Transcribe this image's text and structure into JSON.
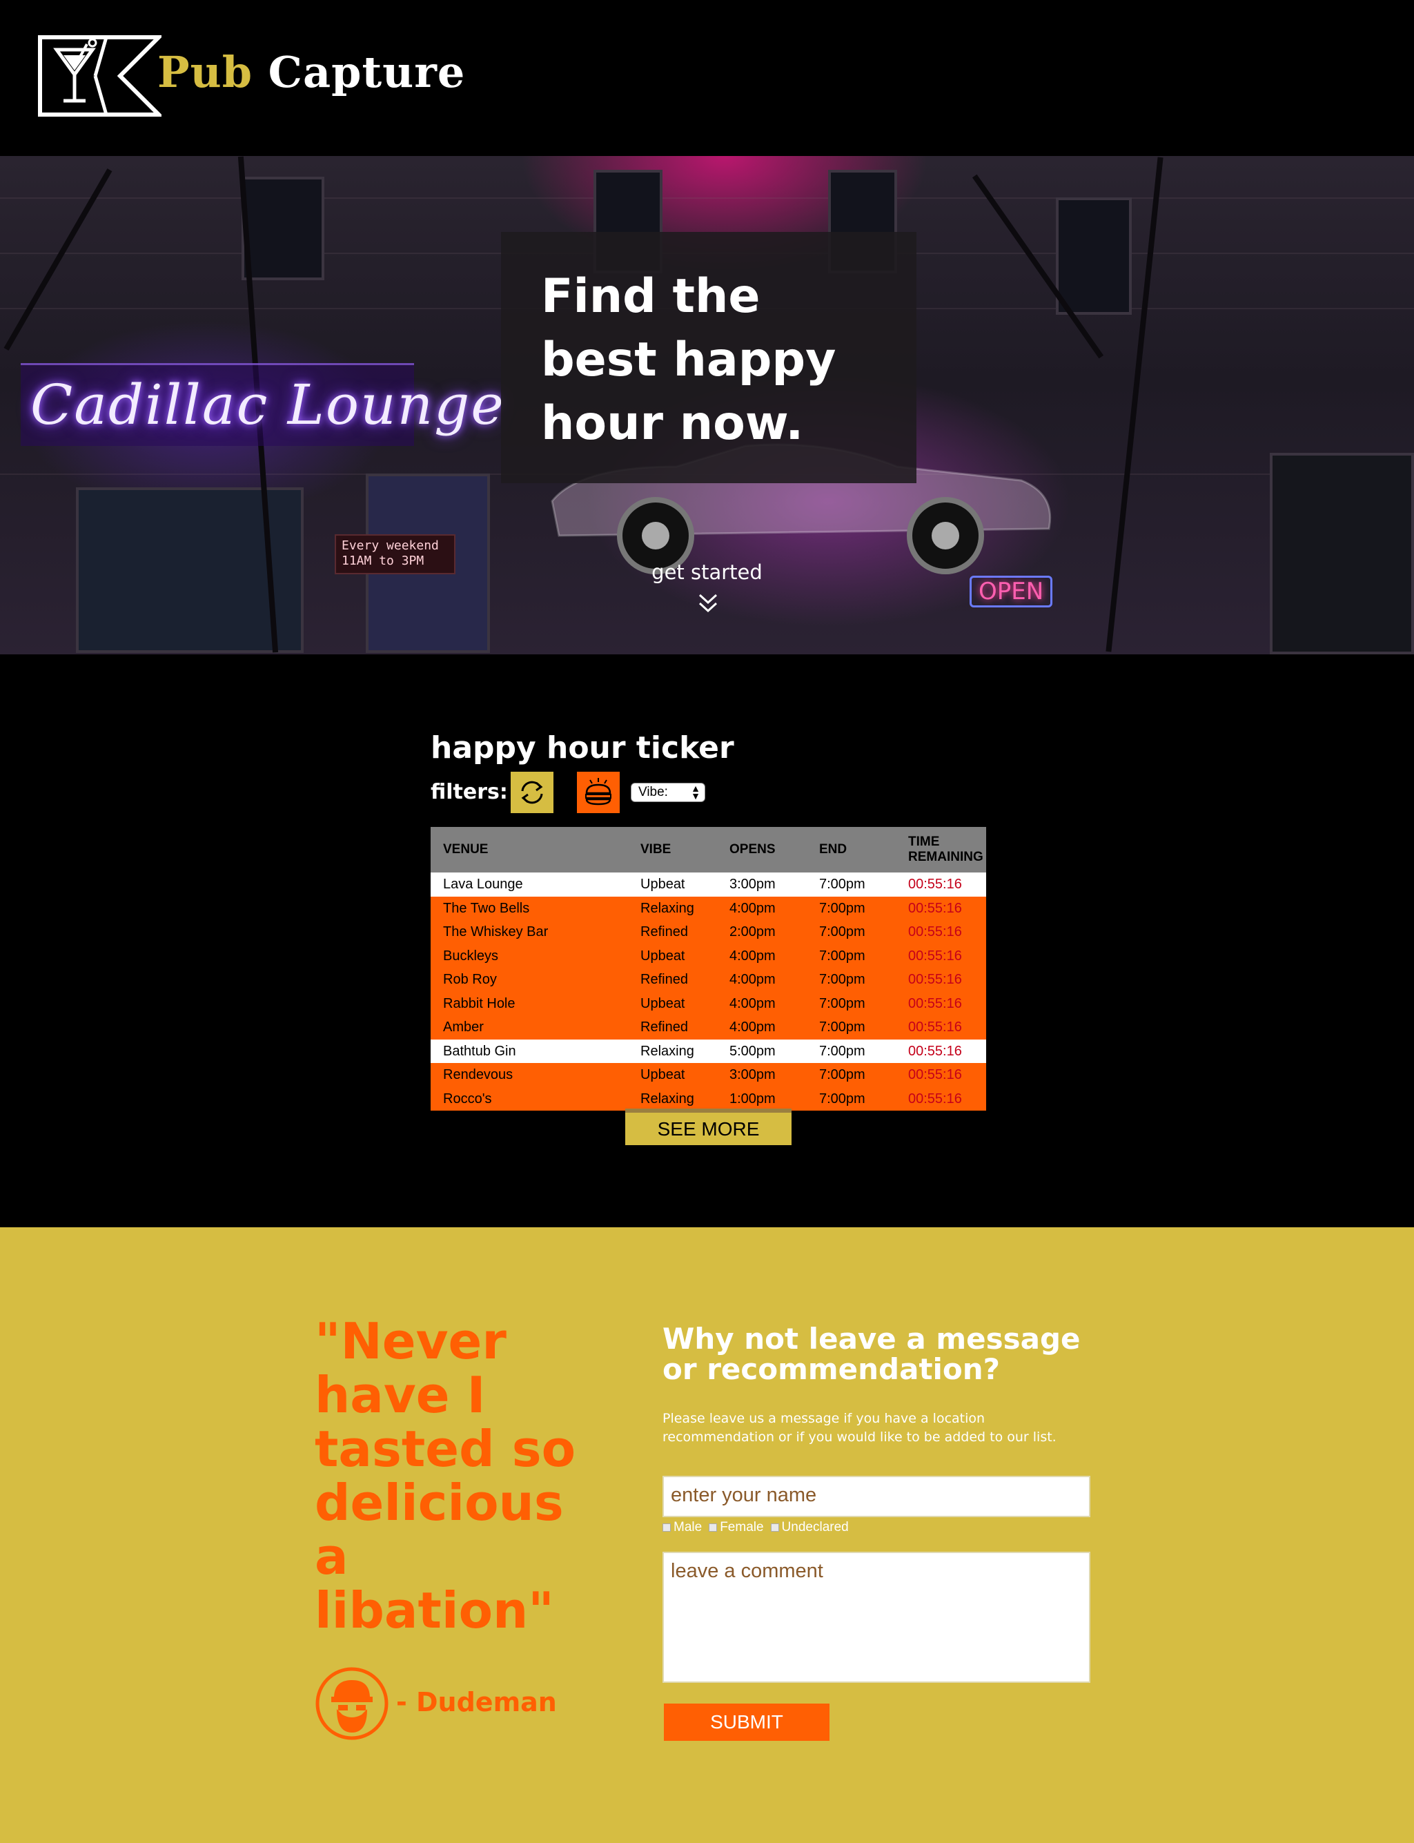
{
  "header": {
    "brand_pub": "Pub",
    "brand_capture": "Capture",
    "logo_icon": "martini-glass-icon"
  },
  "hero": {
    "title": "Find the best happy hour now.",
    "sign_text": "Cadillac Lounge",
    "led_line1": "Every weekend",
    "led_line2": "11AM to 3PM",
    "open_sign": "OPEN",
    "cta": "get started",
    "cta_icon": "double-chevron-down-icon"
  },
  "ticker": {
    "title": "happy hour ticker",
    "filters_label": "filters:",
    "filter_refresh_icon": "refresh-icon",
    "filter_food_icon": "burger-icon",
    "vibe_select": "Vibe:",
    "columns": [
      "VENUE",
      "VIBE",
      "OPENS",
      "END",
      "TIME REMAINING"
    ],
    "rows": [
      {
        "venue": "Lava Lounge",
        "vibe": "Upbeat",
        "opens": "3:00pm",
        "end": "7:00pm",
        "remaining": "00:55:16",
        "style": "white"
      },
      {
        "venue": "The Two Bells",
        "vibe": "Relaxing",
        "opens": "4:00pm",
        "end": "7:00pm",
        "remaining": "00:55:16",
        "style": "orange"
      },
      {
        "venue": "The Whiskey Bar",
        "vibe": "Refined",
        "opens": "2:00pm",
        "end": "7:00pm",
        "remaining": "00:55:16",
        "style": "orange"
      },
      {
        "venue": "Buckleys",
        "vibe": "Upbeat",
        "opens": "4:00pm",
        "end": "7:00pm",
        "remaining": "00:55:16",
        "style": "orange"
      },
      {
        "venue": "Rob Roy",
        "vibe": "Refined",
        "opens": "4:00pm",
        "end": "7:00pm",
        "remaining": "00:55:16",
        "style": "orange"
      },
      {
        "venue": "Rabbit Hole",
        "vibe": "Upbeat",
        "opens": "4:00pm",
        "end": "7:00pm",
        "remaining": "00:55:16",
        "style": "orange"
      },
      {
        "venue": "Amber",
        "vibe": "Refined",
        "opens": "4:00pm",
        "end": "7:00pm",
        "remaining": "00:55:16",
        "style": "orange"
      },
      {
        "venue": "Bathtub Gin",
        "vibe": "Relaxing",
        "opens": "5:00pm",
        "end": "7:00pm",
        "remaining": "00:55:16",
        "style": "white"
      },
      {
        "venue": "Rendevous",
        "vibe": "Upbeat",
        "opens": "3:00pm",
        "end": "7:00pm",
        "remaining": "00:55:16",
        "style": "orange"
      },
      {
        "venue": "Rocco's",
        "vibe": "Relaxing",
        "opens": "1:00pm",
        "end": "7:00pm",
        "remaining": "00:55:16",
        "style": "orange"
      }
    ],
    "see_more": "SEE MORE"
  },
  "message": {
    "quote": "\"Never have I tasted so delicious a libation\"",
    "attribution": "- Dudeman",
    "avatar_icon": "bearded-man-avatar-icon",
    "form_title": "Why not leave a message or recommendation?",
    "form_desc": "Please leave us a message if you have a location recommendation or if you would like to be added to our list.",
    "name_placeholder": "enter your name",
    "gender_options": [
      "Male",
      "Female",
      "Undeclared"
    ],
    "comment_placeholder": "leave a comment",
    "submit": "SUBMIT"
  },
  "colors": {
    "gold": "#d6bd42",
    "orange": "#ff5f03",
    "black": "#000000",
    "time_red": "#c4001a"
  }
}
